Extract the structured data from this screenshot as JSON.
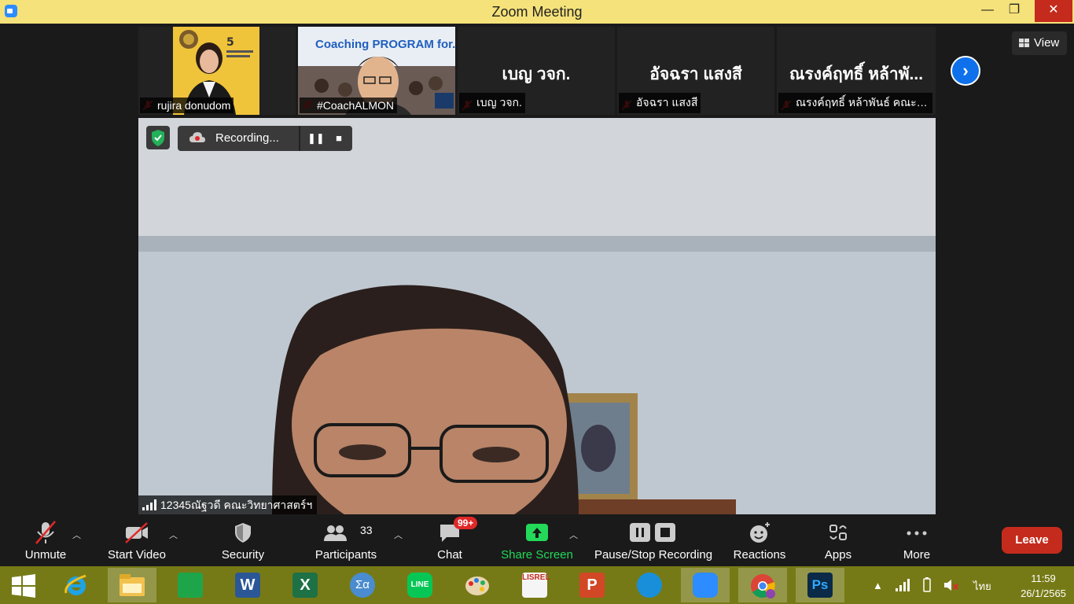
{
  "window": {
    "title": "Zoom Meeting",
    "minimize": "—",
    "maximize": "❐",
    "close": "✕"
  },
  "gallery": {
    "view_label": "View",
    "tiles": [
      {
        "name": "rujira donudom",
        "display": ""
      },
      {
        "name": "#CoachALMON",
        "display": ""
      },
      {
        "name": "เบญ วจก.",
        "display": "เบญ วจก."
      },
      {
        "name": "อัจฉรา แสงสี",
        "display": "อัจฉรา แสงสี"
      },
      {
        "name": "ณรงค์ฤทธิ์ หล้าพันธ์ คณะว...",
        "display": "ณรงค์ฤทธิ์ หล้าพั..."
      }
    ],
    "coach_banner": "Coaching PROGRAM for...er"
  },
  "main_video": {
    "recording_text": "Recording...",
    "speaker_name": "12345ณัฐวดี คณะวิทยาศาสตร์ฯ"
  },
  "toolbar": {
    "unmute": "Unmute",
    "start_video": "Start Video",
    "security": "Security",
    "participants": "Participants",
    "participants_count": "33",
    "chat": "Chat",
    "chat_badge": "99+",
    "share_screen": "Share Screen",
    "pause_stop_recording": "Pause/Stop Recording",
    "reactions": "Reactions",
    "apps": "Apps",
    "more": "More",
    "leave": "Leave",
    "colors": {
      "share": "#23d959",
      "leave": "#c42b1c",
      "muted": "#e02828"
    }
  },
  "taskbar": {
    "apps": [
      "start",
      "internet-explorer",
      "file-explorer",
      "store",
      "word",
      "excel",
      "math-input",
      "line",
      "paint",
      "lisrel",
      "powerpoint",
      "edge",
      "zoom",
      "chrome",
      "photoshop"
    ],
    "tray_language": "ไทย",
    "time": "11:59",
    "date": "26/1/2565"
  }
}
